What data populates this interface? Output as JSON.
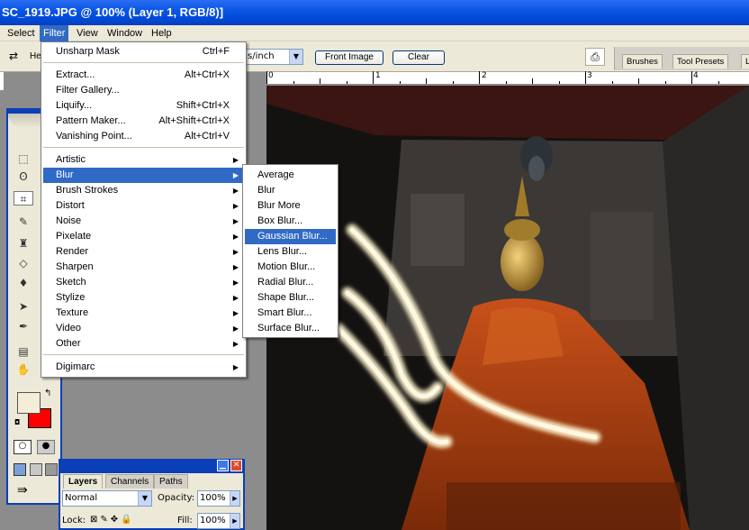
{
  "window": {
    "title": "SC_1919.JPG @ 100% (Layer 1, RGB/8)]"
  },
  "menubar": {
    "items": [
      "Select",
      "Filter",
      "View",
      "Window",
      "Help"
    ],
    "active": "Filter"
  },
  "options": {
    "he_label": "He",
    "resolution_unit": "s/inch",
    "front_image": "Front Image",
    "clear": "Clear",
    "well_tabs": [
      "Brushes",
      "Tool Presets",
      "L"
    ]
  },
  "ruler": {
    "numbers": [
      "0",
      "1",
      "2",
      "3",
      "4"
    ]
  },
  "filter_menu": {
    "items": [
      {
        "label": "Unsharp Mask",
        "shortcut": "Ctrl+F"
      },
      {
        "label": "Extract...",
        "shortcut": "Alt+Ctrl+X"
      },
      {
        "label": "Filter Gallery...",
        "shortcut": ""
      },
      {
        "label": "Liquify...",
        "shortcut": "Shift+Ctrl+X"
      },
      {
        "label": "Pattern Maker...",
        "shortcut": "Alt+Shift+Ctrl+X"
      },
      {
        "label": "Vanishing Point...",
        "shortcut": "Alt+Ctrl+V"
      },
      {
        "label": "Artistic",
        "sub": true
      },
      {
        "label": "Blur",
        "sub": true,
        "highlighted": true
      },
      {
        "label": "Brush Strokes",
        "sub": true
      },
      {
        "label": "Distort",
        "sub": true
      },
      {
        "label": "Noise",
        "sub": true
      },
      {
        "label": "Pixelate",
        "sub": true
      },
      {
        "label": "Render",
        "sub": true
      },
      {
        "label": "Sharpen",
        "sub": true
      },
      {
        "label": "Sketch",
        "sub": true
      },
      {
        "label": "Stylize",
        "sub": true
      },
      {
        "label": "Texture",
        "sub": true
      },
      {
        "label": "Video",
        "sub": true
      },
      {
        "label": "Other",
        "sub": true
      },
      {
        "label": "Digimarc",
        "sub": true
      }
    ]
  },
  "blur_menu": {
    "items": [
      "Average",
      "Blur",
      "Blur More",
      "Box Blur...",
      "Gaussian Blur...",
      "Lens Blur...",
      "Motion Blur...",
      "Radial Blur...",
      "Shape Blur...",
      "Smart Blur...",
      "Surface Blur..."
    ],
    "highlighted": "Gaussian Blur..."
  },
  "layers": {
    "tabs": [
      "Layers",
      "Channels",
      "Paths"
    ],
    "blend_mode": "Normal",
    "opacity_label": "Opacity:",
    "opacity": "100%",
    "lock_label": "Lock:",
    "fill_label": "Fill:",
    "fill": "100%"
  },
  "colors": {
    "accent": "#316ac5",
    "title": "#0a56e4",
    "foreground": "#f6edd8",
    "background": "#ff0000"
  }
}
